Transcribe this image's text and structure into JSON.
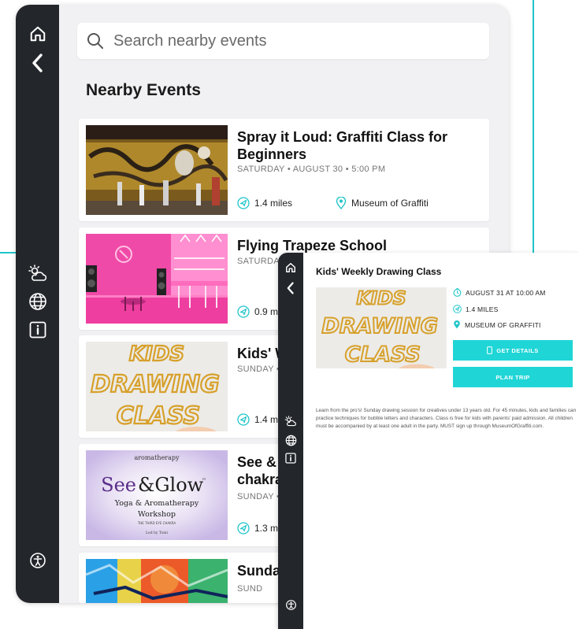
{
  "search": {
    "placeholder": "Search nearby events"
  },
  "section_title": "Nearby Events",
  "events": [
    {
      "title": "Spray it Loud: Graffiti Class for Beginners",
      "date": "SATURDAY • AUGUST 30 • 5:00 PM",
      "distance": "1.4 miles",
      "location": "Museum of Graffiti"
    },
    {
      "title": "Flying Trapeze School",
      "date": "SATURDA",
      "distance": "0.9 m"
    },
    {
      "title": "Kids' W",
      "date": "SUNDAY •",
      "distance": "1.4 m",
      "thumb_text": [
        "KIDS",
        "DRAWING",
        "CLASS"
      ]
    },
    {
      "title": "See &",
      "title_line2": "chakra",
      "date": "SUNDAY •",
      "distance": "1.3 m",
      "thumb_text": {
        "top": "aromatherapy",
        "brand_a": "See",
        "brand_b": "&Glow",
        "tm": "™",
        "sub1": "Yoga & Aromatherapy",
        "sub2": "Workshop",
        "small": "THE THIRD EYE CHAKRA",
        "byline": "Led by Tomi"
      }
    },
    {
      "title": "Sunda",
      "date": "SUND"
    }
  ],
  "detail": {
    "title": "Kids' Weekly Drawing Class",
    "thumb_text": [
      "KIDS",
      "DRAWING",
      "CLASS"
    ],
    "date": "AUGUST 31 AT 10:00 AM",
    "distance": "1.4 MILES",
    "location": "MUSEUM OF GRAFFITI",
    "btn_details": "GET DETAILS",
    "btn_plan": "PLAN TRIP",
    "description": "Learn from the pro's! Sunday drawing session for creatives under 13 years old. For 45 minutes, kids and families can practice techniques for bubble letters and characters. Class is free for kids with parents' paid admission. All children must be accompanied by at least one adult in the party. MUST sign up through MuseumOfGraffiti.com."
  },
  "colors": {
    "accent": "#1fc5c9",
    "sidebar": "#23262b",
    "background": "#f1f1f3",
    "button": "#1fd5d6"
  },
  "icons": {
    "sidebar": [
      "home-icon",
      "back-chevron-icon",
      "weather-icon",
      "globe-icon",
      "info-icon",
      "accessibility-icon"
    ],
    "meta": [
      "navigation-arrow-icon",
      "location-pin-icon",
      "clock-icon"
    ]
  }
}
